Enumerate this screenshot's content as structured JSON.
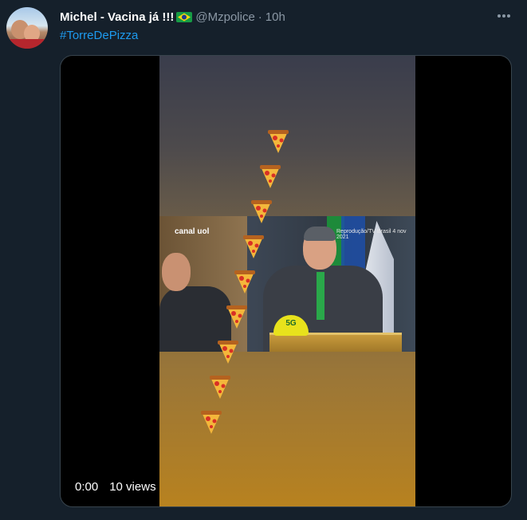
{
  "tweet": {
    "display_name": "Michel - Vacina já !!!",
    "handle": "@Mzpolice",
    "separator": "·",
    "time": "10h",
    "hashtag": "#TorreDePizza"
  },
  "video": {
    "elapsed": "0:00",
    "views": "10 views",
    "channel_logo": "canal uol",
    "credit": "Reprodução/TV Brasil 4 nov 2021",
    "cap_text": "5G"
  },
  "icons": {
    "more": "more-horizontal-icon",
    "flag": "brazil-flag-emoji",
    "pizza": "pizza-slice-emoji"
  },
  "colors": {
    "background": "#15202b",
    "link": "#1d9bf0",
    "secondary_text": "#8b98a5",
    "border": "#38444d"
  }
}
